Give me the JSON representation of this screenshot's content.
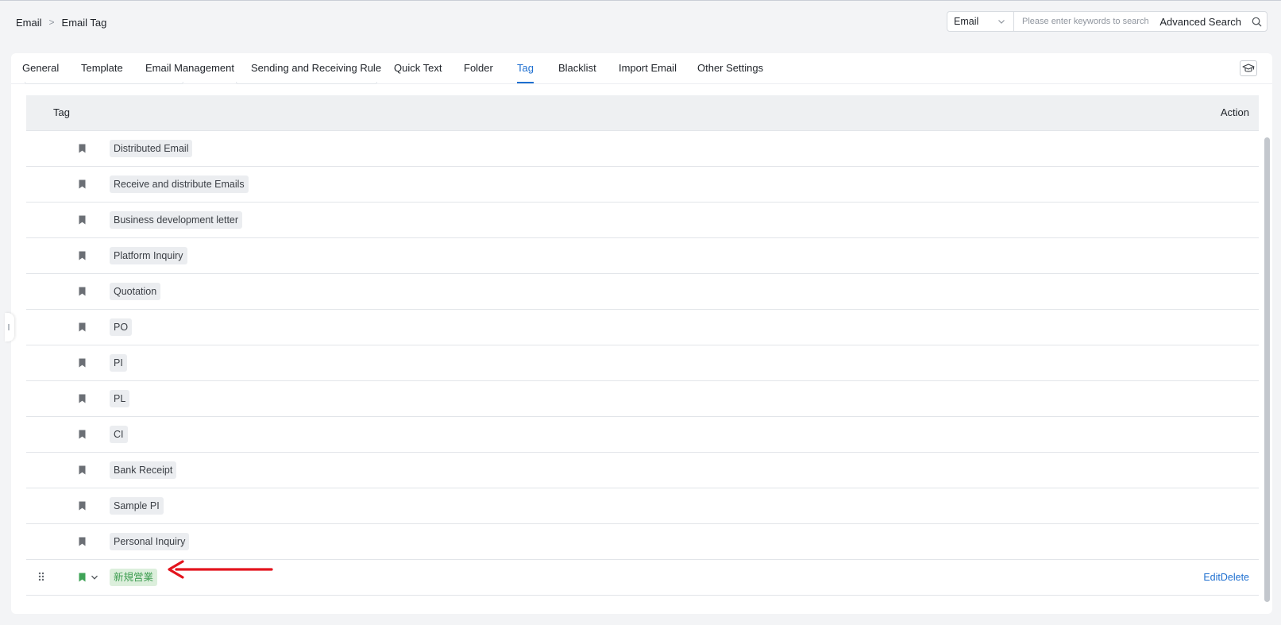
{
  "breadcrumb": {
    "root": "Email",
    "separator": ">",
    "current": "Email Tag"
  },
  "search": {
    "scope": "Email",
    "placeholder": "Please enter keywords to search",
    "advanced_label": "Advanced Search"
  },
  "tabs": [
    {
      "label": "General",
      "active": false
    },
    {
      "label": "Template",
      "active": false
    },
    {
      "label": "Email Management",
      "active": false
    },
    {
      "label": "Sending and Receiving Rule",
      "active": false
    },
    {
      "label": "Quick Text",
      "active": false
    },
    {
      "label": "Folder",
      "active": false
    },
    {
      "label": "Tag",
      "active": true
    },
    {
      "label": "Blacklist",
      "active": false
    },
    {
      "label": "Import Email",
      "active": false
    },
    {
      "label": "Other Settings",
      "active": false
    }
  ],
  "table": {
    "headers": {
      "tag": "Tag",
      "action": "Action"
    },
    "rows": [
      {
        "label": "Distributed Email"
      },
      {
        "label": "Receive and distribute Emails"
      },
      {
        "label": "Business development letter"
      },
      {
        "label": "Platform Inquiry"
      },
      {
        "label": "Quotation"
      },
      {
        "label": "PO"
      },
      {
        "label": "PI"
      },
      {
        "label": "PL"
      },
      {
        "label": "CI"
      },
      {
        "label": "Bank Receipt"
      },
      {
        "label": "Sample PI"
      },
      {
        "label": "Personal Inquiry"
      },
      {
        "label": "新規営業",
        "custom": true,
        "edit_label": "Edit",
        "delete_label": "Delete"
      }
    ]
  },
  "colors": {
    "accent": "#1e6fd0",
    "custom_tag_bg": "#dcefdc",
    "custom_tag_text": "#3e9d51",
    "custom_bookmark": "#3fa357",
    "default_bookmark": "#6b6f75",
    "annotation_arrow": "#e3141d"
  },
  "icons": {
    "scope_dropdown": "chevron-down-icon",
    "search": "search-icon",
    "help": "graduation-cap-icon",
    "row_tag": "bookmark-icon",
    "drag": "drag-handle-icon",
    "row_expand": "chevron-down-icon",
    "annotation": "arrow-left-icon"
  }
}
